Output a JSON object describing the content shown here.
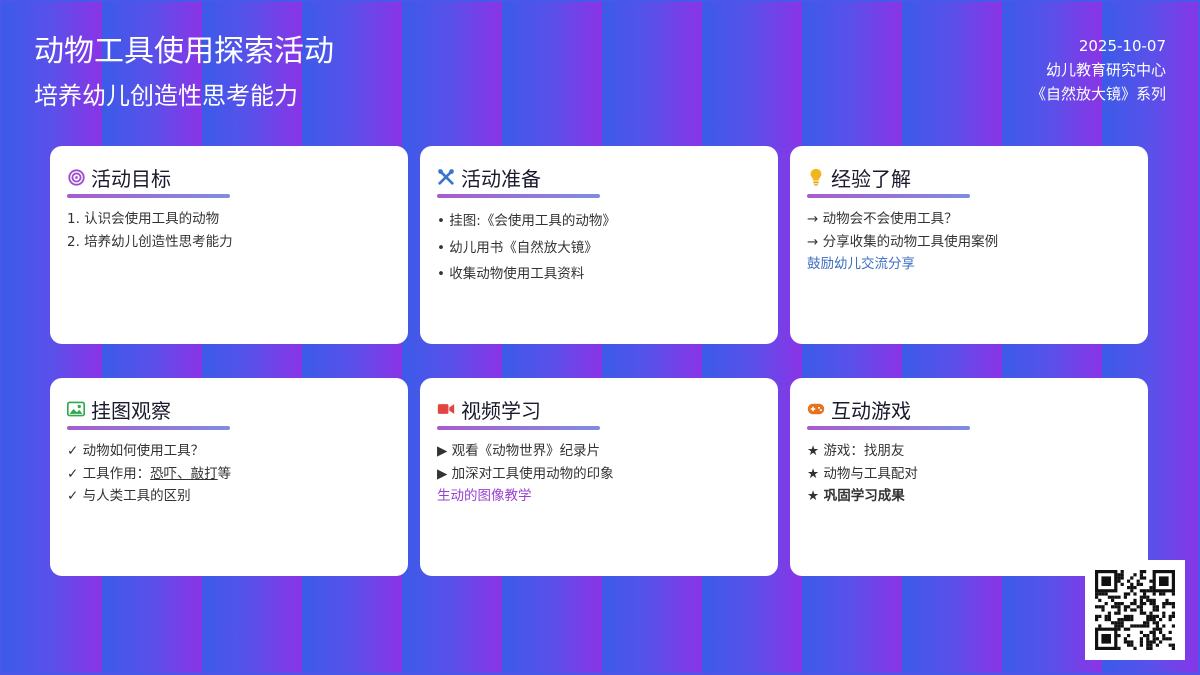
{
  "header": {
    "title": "动物工具使用探索活动",
    "subtitle": "培养幼儿创造性思考能力",
    "date": "2025-10-07",
    "org": "幼儿教育研究中心",
    "series": "《自然放大镜》系列"
  },
  "cards": [
    {
      "title": "活动目标",
      "icon": "target-icon",
      "items": [
        "1. 认识会使用工具的动物",
        "2. 培养幼儿创造性思考能力"
      ]
    },
    {
      "title": "活动准备",
      "icon": "tools-icon",
      "items": [
        "挂图:《会使用工具的动物》",
        "幼儿用书《自然放大镜》",
        "收集动物使用工具资料"
      ]
    },
    {
      "title": "经验了解",
      "icon": "lightbulb-icon",
      "items": [
        "→ 动物会不会使用工具？",
        "→ 分享收集的动物工具使用案例"
      ],
      "note": "鼓励幼儿交流分享"
    },
    {
      "title": "挂图观察",
      "icon": "image-icon",
      "items": [
        "✓ 动物如何使用工具？",
        "✓ 与人类工具的区别"
      ],
      "tool_prefix": "✓ 工具作用：",
      "tool_link": "恐吓、敲打",
      "tool_suffix": "等"
    },
    {
      "title": "视频学习",
      "icon": "video-icon",
      "items": [
        "▶ 观看《动物世界》纪录片",
        "▶ 加深对工具使用动物的印象"
      ],
      "note": "生动的图像教学"
    },
    {
      "title": "互动游戏",
      "icon": "gamepad-icon",
      "items": [
        "★ 游戏：找朋友",
        "★ 动物与工具配对",
        "★ 巩固学习成果"
      ]
    }
  ],
  "colors": {
    "accent_blue": "#3e6fc2",
    "accent_purple": "#9b3fd1",
    "card_bg": "#ffffff"
  }
}
